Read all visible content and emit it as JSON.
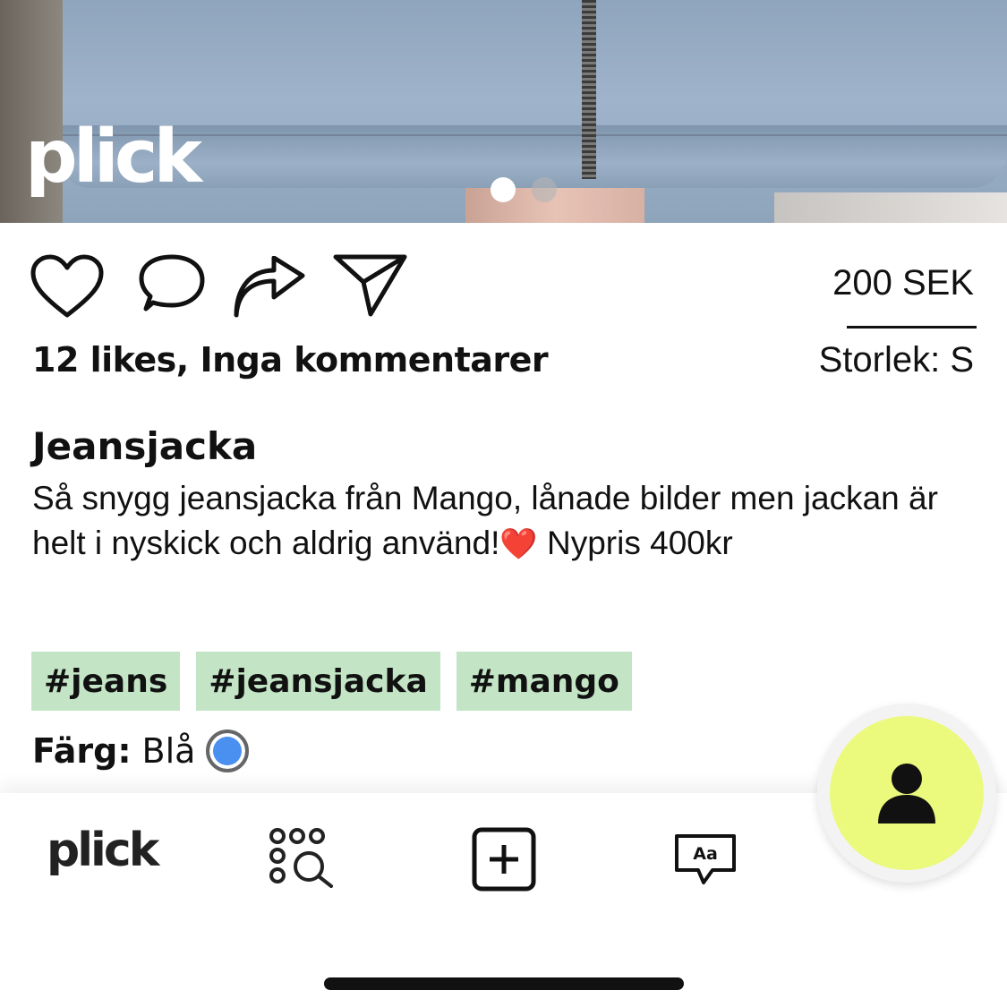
{
  "header": {
    "logo_text": "plick",
    "carousel": {
      "count": 2,
      "active_index": 0
    }
  },
  "actions": {
    "like_icon": "heart-outline-icon",
    "comment_icon": "speech-bubble-icon",
    "share_icon": "share-arrow-icon",
    "send_icon": "paper-plane-icon"
  },
  "listing": {
    "price": "200 SEK",
    "size": "Storlek: S",
    "stats": "12 likes, Inga kommentarer",
    "title": "Jeansjacka",
    "description_part1": "Så snygg jeansjacka från Mango, lånade bilder men jackan är helt i nyskick och aldrig använd!",
    "description_heart": "❤️",
    "description_part2": " Nypris 400kr",
    "tags": [
      "#jeans",
      "#jeansjacka",
      "#mango"
    ],
    "color_label": "Färg:",
    "color_value": "Blå",
    "color_hex": "#4a90f0",
    "tag_bg": "#c3e5c6"
  },
  "bottom_nav": {
    "logo_text": "plick",
    "browse_icon": "browse-search-icon",
    "add_icon": "add-listing-icon",
    "messages_icon": "messages-icon",
    "messages_glyph": "Aa",
    "profile_icon": "profile-person-icon",
    "profile_bg": "#ebfa7d"
  }
}
